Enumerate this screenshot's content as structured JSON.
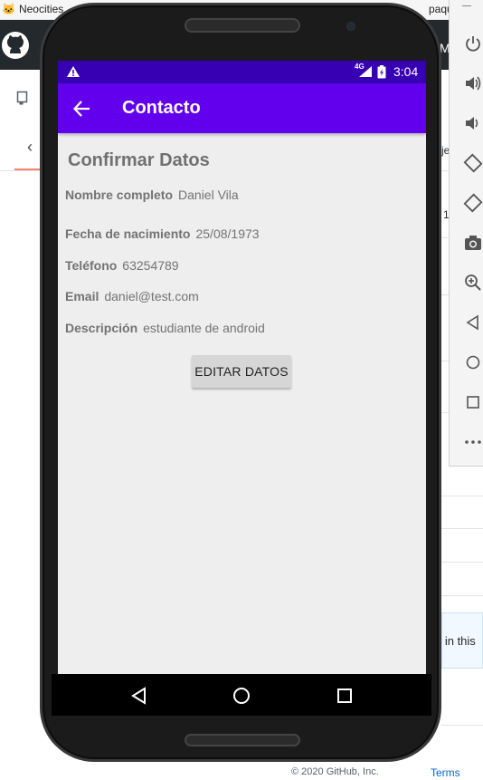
{
  "bookmarks": [
    {
      "label": "Neocities",
      "icon": "cat-icon"
    },
    {
      "label": "paquetac",
      "icon": "bookmark-icon"
    }
  ],
  "background": {
    "github_right_text": "M",
    "partial_texts": [
      "je",
      "1",
      "!"
    ],
    "info_banner_text": "d in this",
    "footer_copyright": "© 2020 GitHub, Inc.",
    "footer_terms": "Terms"
  },
  "emulator_controls": [
    {
      "name": "power-icon"
    },
    {
      "name": "volume-up-icon"
    },
    {
      "name": "volume-down-icon"
    },
    {
      "name": "rotate-left-icon"
    },
    {
      "name": "rotate-right-icon"
    },
    {
      "name": "camera-icon"
    },
    {
      "name": "zoom-icon"
    },
    {
      "name": "back-icon"
    },
    {
      "name": "home-icon"
    },
    {
      "name": "overview-icon"
    },
    {
      "name": "more-icon"
    }
  ],
  "statusbar": {
    "network": "4G",
    "time": "3:04"
  },
  "appbar": {
    "title": "Contacto"
  },
  "content": {
    "title": "Confirmar Datos",
    "fields": [
      {
        "label": "Nombre completo",
        "value": "Daniel Vila"
      },
      {
        "label": "Fecha de nacimiento",
        "value": "25/08/1973"
      },
      {
        "label": "Teléfono",
        "value": "63254789"
      },
      {
        "label": "Email",
        "value": "daniel@test.com"
      },
      {
        "label": "Descripción",
        "value": "estudiante de android"
      }
    ],
    "edit_button": "EDITAR DATOS"
  },
  "colors": {
    "status_bar": "#3700b3",
    "app_bar": "#6200ee",
    "screen_bg": "#eeeeee"
  }
}
